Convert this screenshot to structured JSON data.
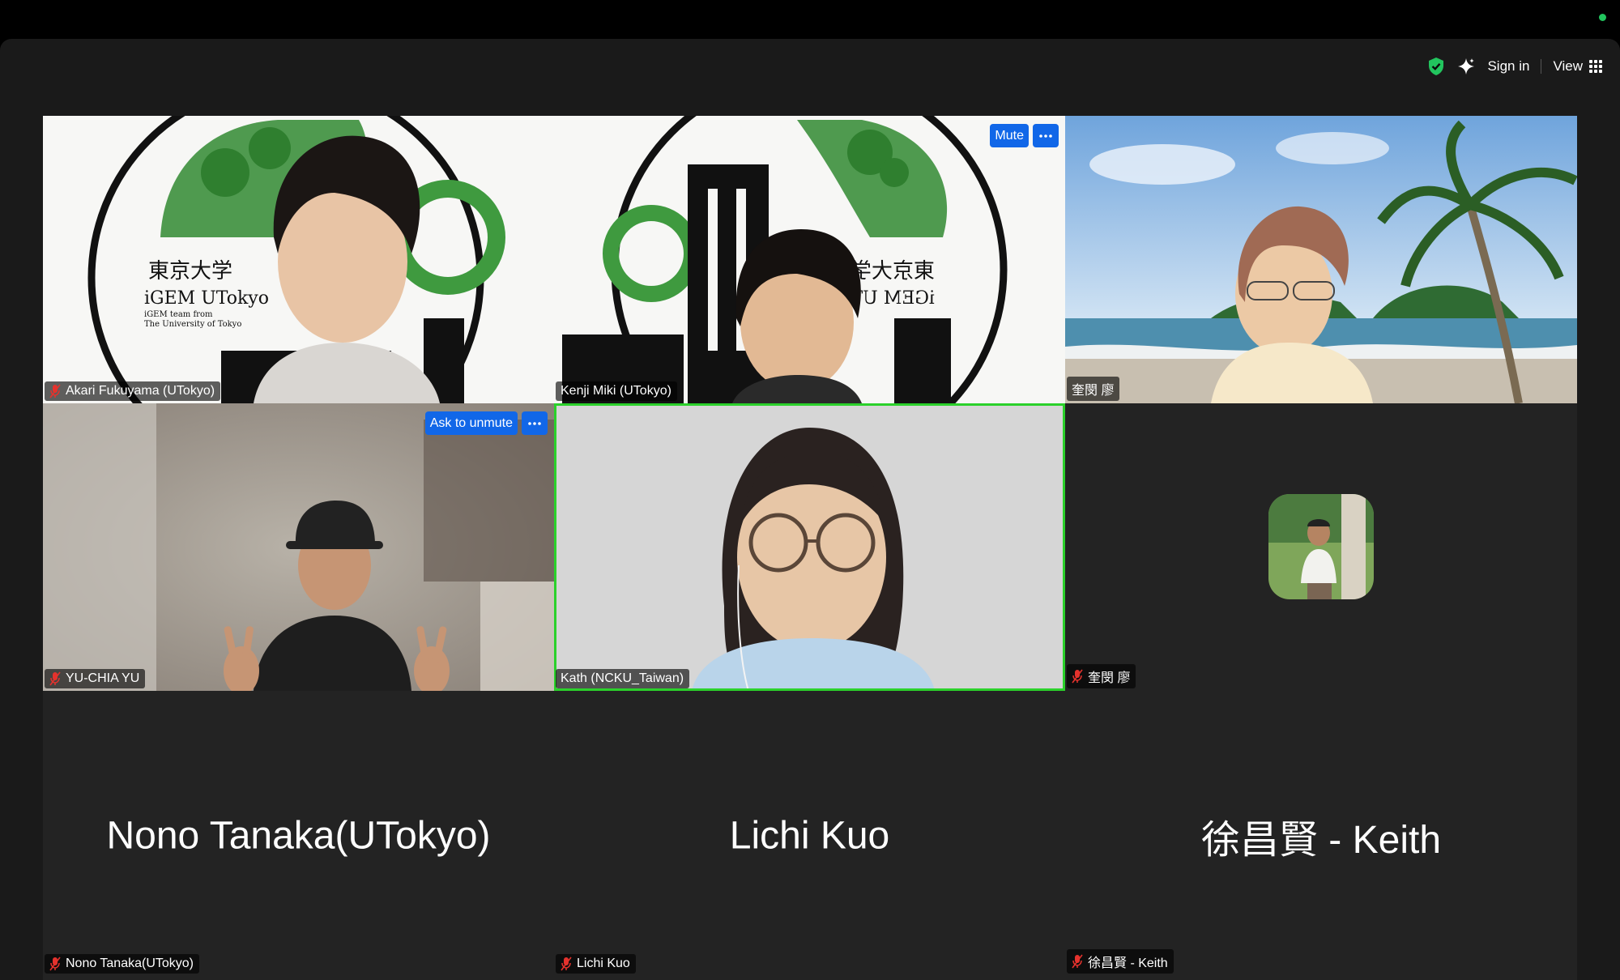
{
  "toolbar": {
    "sign_in_label": "Sign in",
    "view_label": "View",
    "shield_color": "#22c55e",
    "icons": [
      "shield-check-icon",
      "sparkle-icon",
      "grid-view-icon"
    ]
  },
  "tiles": [
    {
      "name": "Akari Fukuyama (UTokyo)",
      "muted": true,
      "video": true
    },
    {
      "name": "Kenji Miki (UTokyo)",
      "muted": false,
      "video": true,
      "buttons": {
        "primary": "Mute"
      }
    },
    {
      "name": "奎閔 廖",
      "muted": false,
      "video": true
    },
    {
      "name": "YU-CHIA YU",
      "muted": true,
      "video": true,
      "buttons": {
        "primary": "Ask to unmute"
      }
    },
    {
      "name": "Kath (NCKU_Taiwan)",
      "muted": false,
      "video": true,
      "active_speaker": true
    },
    {
      "name": "奎閔 廖",
      "muted": true,
      "video": false,
      "avatar": true
    },
    {
      "name": "Nono Tanaka(UTokyo)",
      "display_name": "Nono Tanaka(UTokyo)",
      "muted": true,
      "video": false
    },
    {
      "name": "Lichi Kuo",
      "display_name": "Lichi Kuo",
      "muted": true,
      "video": false
    },
    {
      "name": "徐昌賢 - Keith",
      "display_name": "徐昌賢 - Keith",
      "muted": true,
      "video": false
    }
  ],
  "logo_text": {
    "line1": "東京大学",
    "line2": "iGEM UTokyo",
    "line3": "iGEM team from",
    "line4": "The University of Tokyo"
  },
  "colors": {
    "active_speaker_border": "#2bd12b",
    "button_blue": "#1167e8"
  }
}
